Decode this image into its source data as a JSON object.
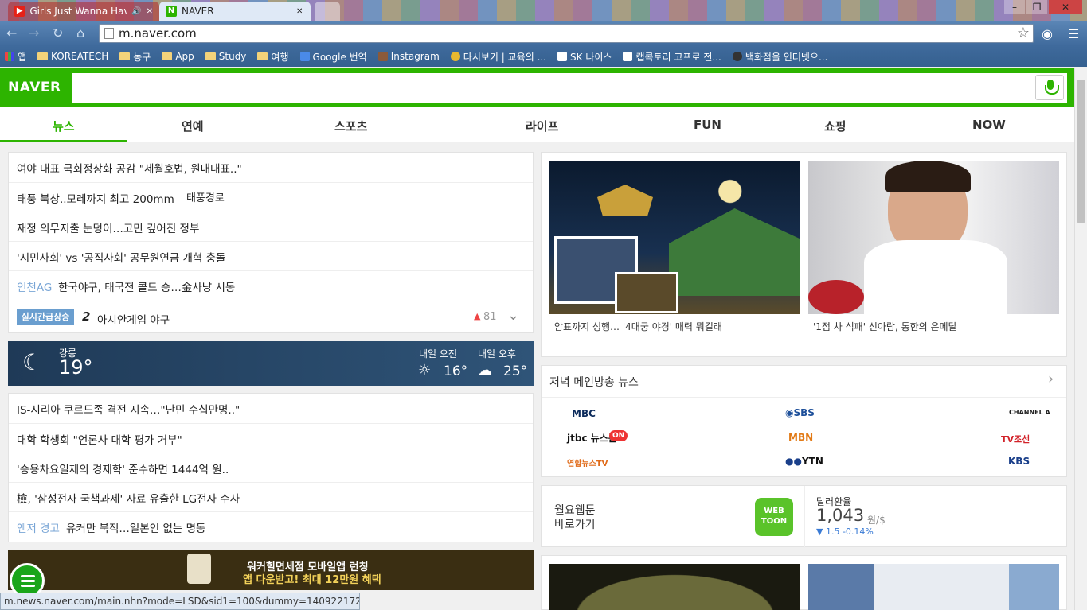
{
  "browser": {
    "tabs": [
      {
        "title": "Girls Just Wanna Have",
        "mute": "🔊",
        "close": "✕"
      },
      {
        "title": "NAVER",
        "close": "✕"
      }
    ],
    "url": "m.naver.com",
    "status_url": "m.news.naver.com/main.nhn?mode=LSD&sid1=100&dummy=1409221724",
    "bookmarks": [
      "앱",
      "KOREATECH",
      "농구",
      "App",
      "Study",
      "여행",
      "Google 번역",
      "Instagram",
      "다시보기 | 교육의 ...",
      "SK 나이스",
      "캡콕토리 고프로 전...",
      "백화점을 인터넷으..."
    ]
  },
  "naver": {
    "logo": "NAVER",
    "categories": [
      "뉴스",
      "연예",
      "스포츠",
      "라이프",
      "FUN",
      "쇼핑",
      "NOW"
    ],
    "news1": [
      "여야 대표 국회정상화 공감 \"세월호법, 원내대표..\"",
      "태풍 북상..모레까지 최고 200mm",
      "재정 의무지출 눈덩이…고민 깊어진 정부",
      "'시민사회' vs '공직사회' 공무원연금 개혁 충돌",
      "한국야구, 태국전 콜드 승…金사냥 시동"
    ],
    "news1_extra": "태풍경로",
    "news1_tag": "인천AG",
    "realtime": {
      "badge": "실시간급상승",
      "rank": "2",
      "keyword": "아시안게임 야구",
      "count": "81"
    },
    "weather": {
      "city": "강릉",
      "temp": "19°",
      "tomorrow_am_label": "내일 오전",
      "tomorrow_am": "16°",
      "tomorrow_pm_label": "내일 오후",
      "tomorrow_pm": "25°"
    },
    "news2": [
      "IS-시리아 쿠르드족 격전 지속…\"난민 수십만명..\"",
      "대학 학생회 \"언론사 대학 평가 거부\"",
      "'승용차요일제의 경제학' 준수하면 1444억 원..",
      "檢, '삼성전자 국책과제' 자료 유출한 LG전자 수사",
      "유커만 북적…일본인 없는 명동"
    ],
    "news2_tag": "엔저 경고",
    "photos": [
      {
        "caption": "암표까지 성행… '4대궁 야경' 매력 뭐길래"
      },
      {
        "caption": "'1점 차 석패' 신아람, 통한의 은메달"
      }
    ],
    "broadcast": {
      "title": "저녁 메인방송 뉴스",
      "channels": [
        "MBC",
        "SBS",
        "CHANNEL A",
        "jtbc 뉴스룸",
        "ON",
        "MBN",
        "TV조선",
        "연합뉴스TV",
        "YTN",
        "KBS"
      ],
      "colors": {
        "mbc": "#0b2a5b",
        "sbs": "#1d4f9a",
        "mbn": "#e27a16",
        "tvc": "#d2232a",
        "yonhap": "#e06b1a",
        "kbs": "#1a3f8a"
      }
    },
    "webtoon": {
      "line1": "월요웹툰",
      "line2": "바로가기",
      "logo": "WEB TOON"
    },
    "exchange": {
      "title": "달러환율",
      "value": "1,043",
      "unit": "원/$",
      "change": "▼ 1.5 -0.14%"
    },
    "banner": {
      "line1": "워커힐면세점 모바일앱 런칭",
      "line2": "앱 다운받고! 최대 12만원 혜택"
    }
  }
}
